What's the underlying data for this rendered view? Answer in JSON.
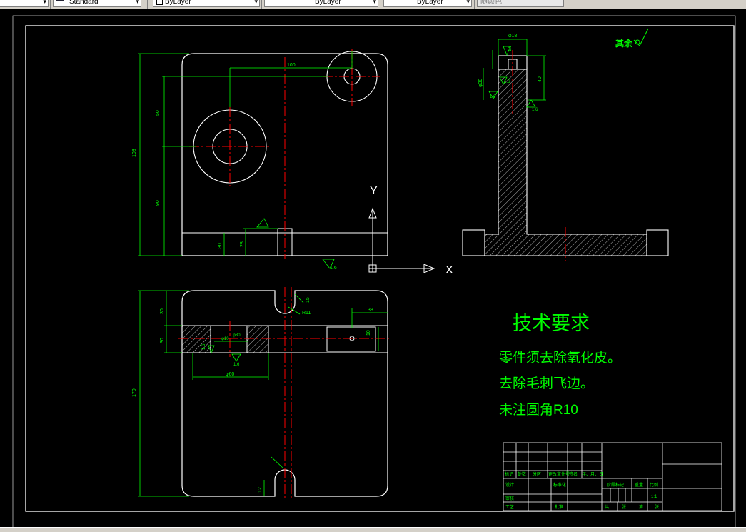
{
  "toolbar": {
    "text_style": "Standard",
    "layer": "ByLayer",
    "linetype": "ByLayer",
    "lineweight": "ByLayer",
    "plot_style": "随颜色"
  },
  "colors": {
    "background": "#000000",
    "geometry": "#ffffff",
    "dimension": "#00ff00",
    "centerline": "#ff0000",
    "annotation": "#00ff00"
  },
  "drawing": {
    "roughness_note": "其余",
    "axis_y": "Y",
    "axis_x": "X",
    "front_dims": {
      "d108": "108",
      "d50": "50",
      "d100": "100",
      "d90": "90",
      "d30a": "30",
      "d28": "28",
      "r16": "1.6"
    },
    "side_dims": {
      "d18": "φ18",
      "d40": "40",
      "d30": "φ30",
      "d16": "1.6",
      "d16b": "1.6",
      "d16c": "1.6",
      "d16d": "1.6"
    },
    "top_dims": {
      "d30": "30",
      "d30b": "30",
      "d170": "170",
      "d15": "15",
      "d12": "12",
      "r11": "R11",
      "d38": "38",
      "d10": "10",
      "phi10": "φ10",
      "phi30": "φ30",
      "phi60": "φ60",
      "r16a": "1.6",
      "r16b": "1.6"
    }
  },
  "tech_requirements": {
    "title": "技术要求",
    "lines": [
      "零件须去除氧化皮。",
      "去除毛刺飞边。",
      "未注圆角R10"
    ]
  },
  "title_block": {
    "marks": "标记",
    "count": "处数",
    "zone": "分区",
    "doc_no": "更改文件号",
    "sign": "签名",
    "date": "年、月、日",
    "design": "设计",
    "standard": "标准化",
    "stage_mark": "阶段标记",
    "weight": "重量",
    "scale": "比例",
    "scale_value": "1:1",
    "review": "审核",
    "process": "工艺",
    "approve": "批准",
    "total": "共",
    "sheet": "张",
    "page": "第",
    "page_unit": "张"
  }
}
